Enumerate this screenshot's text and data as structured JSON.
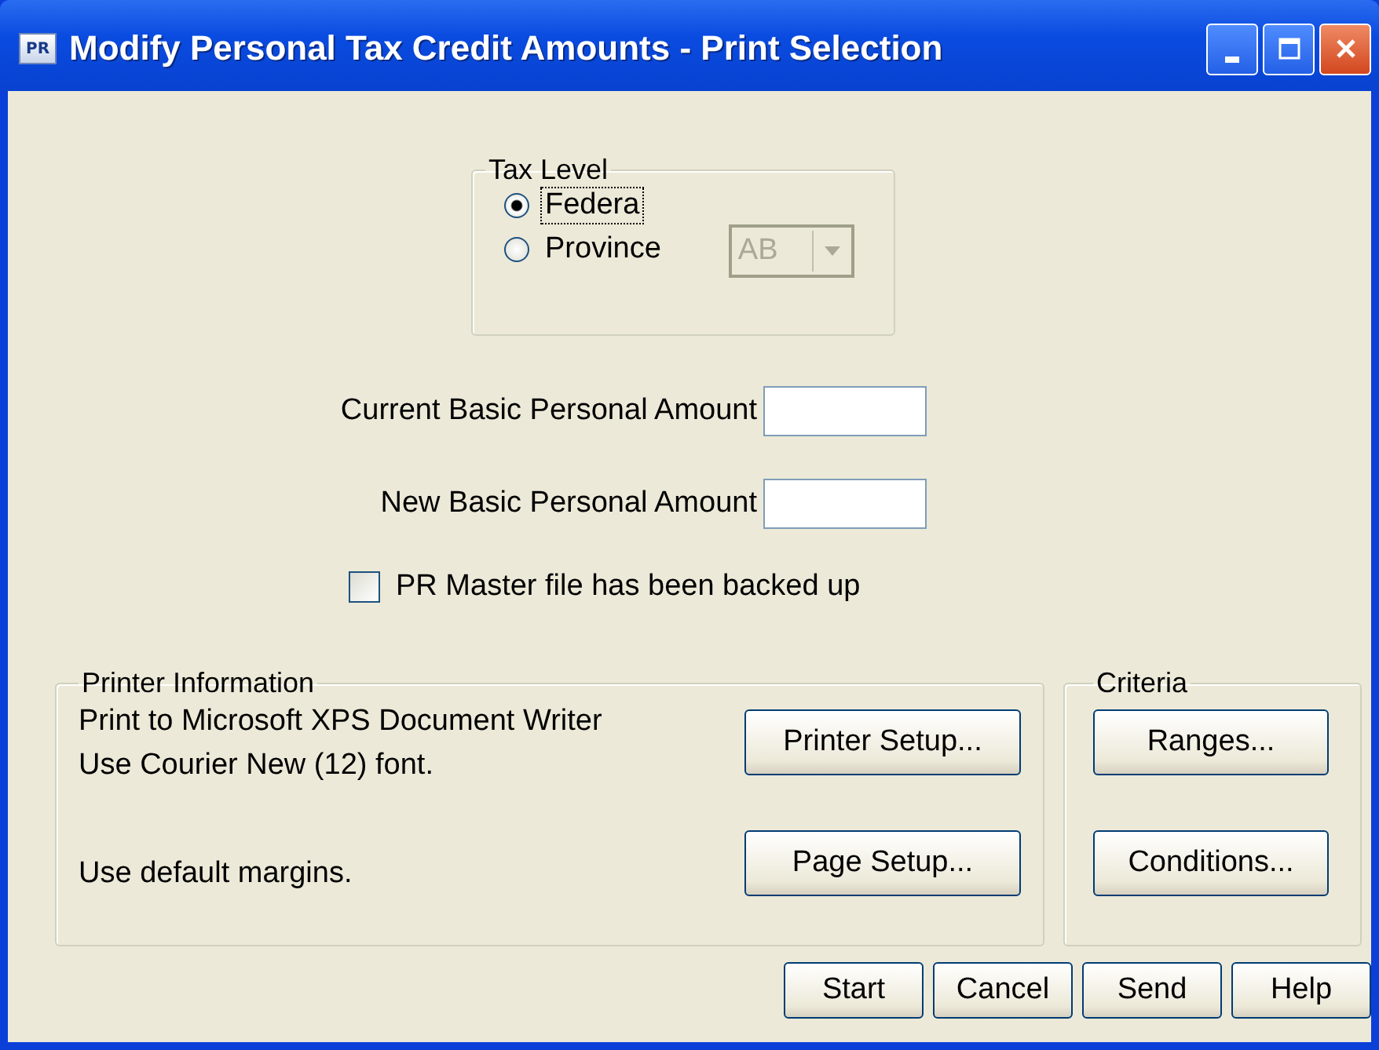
{
  "window": {
    "title": "Modify Personal Tax Credit Amounts - Print Selection",
    "app_icon": "PR"
  },
  "tax_level": {
    "title": "Tax Level",
    "options": [
      {
        "label": "Federa",
        "selected": true,
        "focused": true
      },
      {
        "label": "Province",
        "selected": false,
        "focused": false
      }
    ],
    "province_select": {
      "value": "AB",
      "disabled": true
    }
  },
  "fields": [
    {
      "label": "Current Basic Personal Amount"
    },
    {
      "label": "New Basic Personal Amount"
    }
  ],
  "backup_checkbox": {
    "label": "PR Master file has been backed up",
    "checked": false
  },
  "printer_info": {
    "title": "Printer Information",
    "lines": [
      "Print to Microsoft XPS Document Writer",
      "Use Courier New (12) font."
    ],
    "margins": "Use default margins.",
    "buttons": [
      {
        "label": "Printer Setup..."
      },
      {
        "label": "Page Setup..."
      }
    ]
  },
  "criteria": {
    "title": "Criteria",
    "buttons": [
      {
        "label": "Ranges..."
      },
      {
        "label": "Conditions..."
      }
    ]
  },
  "buttons": [
    {
      "label": "Start"
    },
    {
      "label": "Cancel"
    },
    {
      "label": "Send"
    },
    {
      "label": "Help"
    }
  ]
}
